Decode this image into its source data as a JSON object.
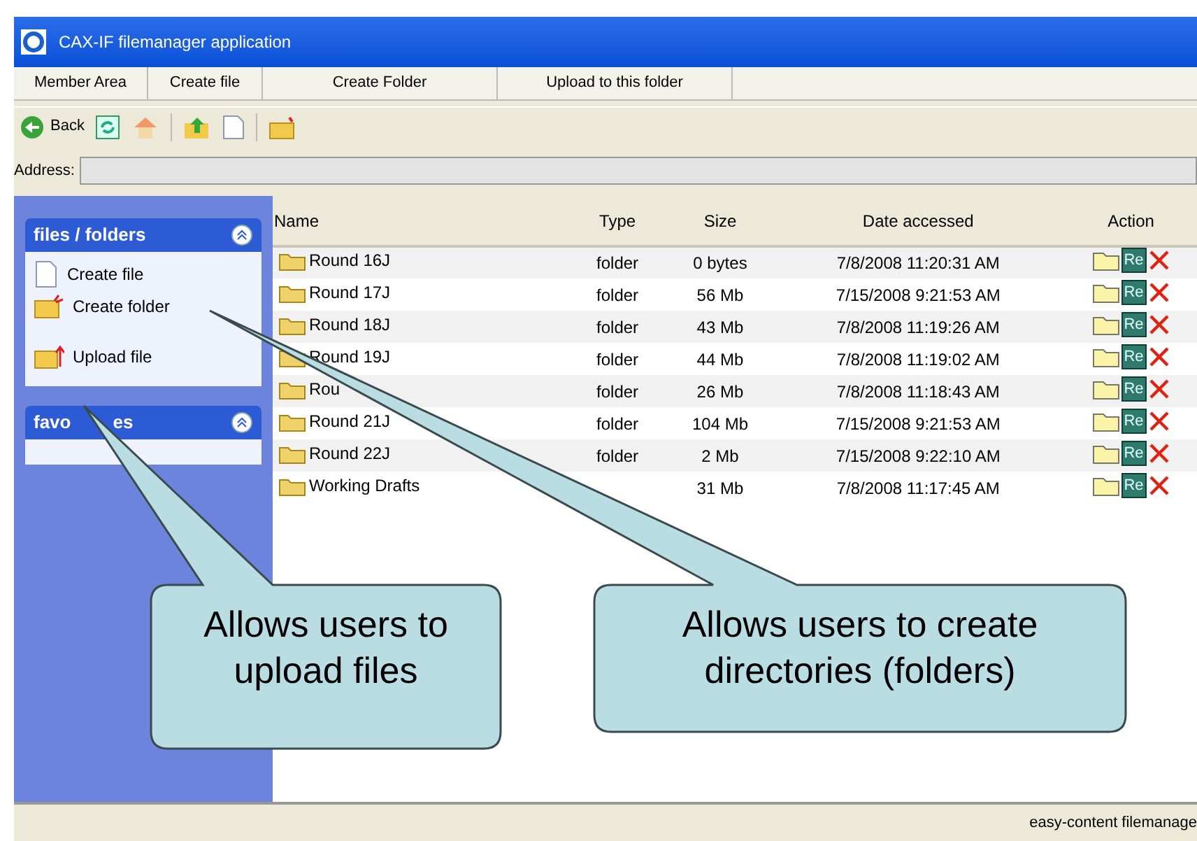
{
  "window": {
    "title": "CAX-IF filemanager application"
  },
  "menu_tabs": [
    {
      "label": "Member Area"
    },
    {
      "label": "Create file"
    },
    {
      "label": "Create Folder"
    },
    {
      "label": "Upload to this folder"
    }
  ],
  "toolbar": {
    "back_label": "Back"
  },
  "address": {
    "label": "Address:"
  },
  "sidebar": {
    "panels": [
      {
        "title": "files / folders",
        "expanded": true,
        "items": [
          {
            "label": "Create file",
            "kind": "file"
          },
          {
            "label": "Create folder",
            "kind": "newfolder"
          },
          {
            "label": "Upload file",
            "kind": "upload"
          }
        ]
      },
      {
        "title": "favo",
        "title_tail": "es",
        "expanded": true
      }
    ]
  },
  "table": {
    "columns": [
      "Name",
      "Type",
      "Size",
      "Date accessed",
      "Action"
    ],
    "rows": [
      {
        "name": "Round 16J",
        "type": "folder",
        "size": "0 bytes",
        "date": "7/8/2008 11:20:31 AM",
        "rename_label": "Re"
      },
      {
        "name": "Round 17J",
        "type": "folder",
        "size": "56 Mb",
        "date": "7/15/2008 9:21:53 AM",
        "rename_label": "Re"
      },
      {
        "name": "Round 18J",
        "type": "folder",
        "size": "43 Mb",
        "date": "7/8/2008 11:19:26 AM",
        "rename_label": "Re"
      },
      {
        "name": "Round 19J",
        "type": "folder",
        "size": "44 Mb",
        "date": "7/8/2008 11:19:02 AM",
        "rename_label": "Re"
      },
      {
        "name": "Rou",
        "type": "folder",
        "size": "26 Mb",
        "date": "7/8/2008 11:18:43 AM",
        "rename_label": "Re"
      },
      {
        "name": "Round 21J",
        "type": "folder",
        "size": "104 Mb",
        "date": "7/15/2008 9:21:53 AM",
        "rename_label": "Re"
      },
      {
        "name": "Round 22J",
        "type": "folder",
        "size": "2 Mb",
        "date": "7/15/2008 9:22:10 AM",
        "rename_label": "Re"
      },
      {
        "name": "Working Drafts",
        "size": "31 Mb",
        "date": "7/8/2008 11:17:45 AM",
        "rename_label": "Re"
      }
    ]
  },
  "status_bar": {
    "text": "easy-content filemanage"
  },
  "callouts": [
    {
      "text": "Allows users to upload files"
    },
    {
      "text": "Allows users to create directories (folders)"
    }
  ]
}
